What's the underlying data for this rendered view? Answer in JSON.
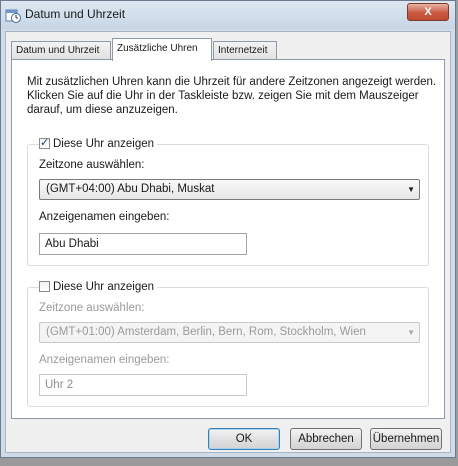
{
  "window": {
    "title": "Datum und Uhrzeit",
    "close_symbol": "X",
    "icon": "clock-calendar-icon"
  },
  "tabs": [
    {
      "label": "Datum und Uhrzeit",
      "active": false
    },
    {
      "label": "Zusätzliche Uhren",
      "active": true
    },
    {
      "label": "Internetzeit",
      "active": false
    }
  ],
  "intro_text": "Mit zusätzlichen Uhren kann die Uhrzeit für andere Zeitzonen angezeigt werden. Klicken Sie auf die Uhr in der Taskleiste bzw. zeigen Sie mit dem Mauszeiger darauf, um diese anzuzeigen.",
  "clock1": {
    "checkbox_label": "Diese Uhr anzeigen",
    "checked": true,
    "timezone_label": "Zeitzone auswählen:",
    "timezone_value": "(GMT+04:00) Abu Dhabi, Muskat",
    "name_label": "Anzeigenamen eingeben:",
    "name_value": "Abu Dhabi"
  },
  "clock2": {
    "checkbox_label": "Diese Uhr anzeigen",
    "checked": false,
    "timezone_label": "Zeitzone auswählen:",
    "timezone_value": "(GMT+01:00) Amsterdam, Berlin, Bern, Rom, Stockholm, Wien",
    "name_label": "Anzeigenamen eingeben:",
    "name_value": "Uhr 2"
  },
  "buttons": {
    "ok": "OK",
    "cancel": "Abbrechen",
    "apply": "Übernehmen"
  },
  "glyphs": {
    "check": "✓",
    "dropdown_arrow": "▼"
  }
}
